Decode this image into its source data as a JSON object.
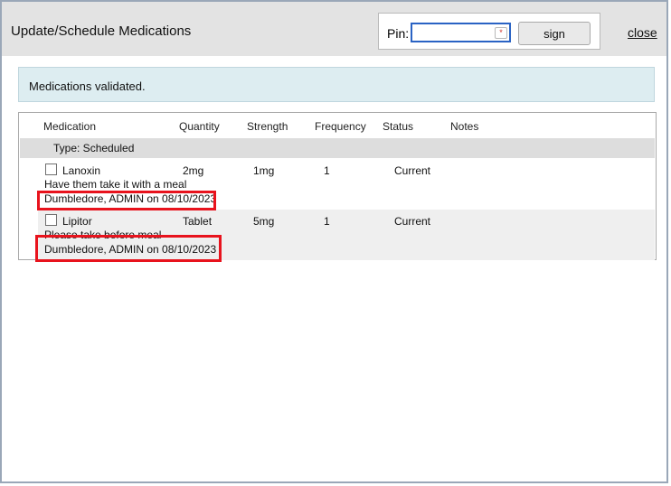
{
  "dialog": {
    "title": "Update/Schedule Medications",
    "pin_label": "Pin:",
    "pin_value": "",
    "required_icon": "*",
    "sign_label": "sign",
    "close_label": "close"
  },
  "alert": {
    "message": "Medications validated."
  },
  "grid": {
    "columns": [
      "Medication",
      "Quantity",
      "Strength",
      "Frequency",
      "Status",
      "Notes"
    ],
    "group_label": "Type: Scheduled",
    "rows": [
      {
        "checked": false,
        "medication": "Lanoxin",
        "quantity": "2mg",
        "strength": "1mg",
        "frequency": "1",
        "status": "Current",
        "note": "Have them take it with a meal",
        "signed_by": "Dumbledore, ADMIN on 08/10/2023"
      },
      {
        "checked": false,
        "medication": "Lipitor",
        "quantity": "Tablet",
        "strength": "5mg",
        "frequency": "1",
        "status": "Current",
        "note": "Please take before meal",
        "signed_by": "Dumbledore, ADMIN on 08/10/2023"
      }
    ]
  },
  "annotations": {
    "highlight_color": "#e8131d"
  }
}
